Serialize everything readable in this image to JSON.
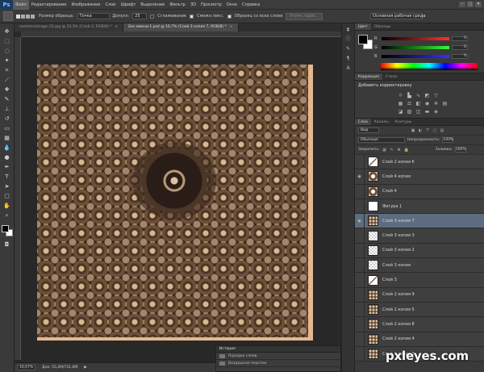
{
  "app": {
    "logo": "Ps",
    "menu": [
      "Файл",
      "Редактирование",
      "Изображение",
      "Слои",
      "Шрифт",
      "Выделение",
      "Фильтр",
      "3D",
      "Просмотр",
      "Окно",
      "Справка"
    ],
    "window_buttons": [
      "–",
      "□",
      "✕"
    ]
  },
  "options": {
    "sample_size_label": "Размер образца:",
    "sample_size_value": "Точка",
    "tolerance_label": "Допуск:",
    "tolerance_value": "25",
    "antialias_label": "Сглаживание",
    "contiguous_label": "Смежн.пикс.",
    "all_layers_label": "Образец со всех слоев",
    "refine_button": "Уточн. край...",
    "workspace": "Основная рабочая среда"
  },
  "tabs": [
    {
      "label": "seamlessimage (3).jpg @ 33,3% (Слой 2, RGB/8) *",
      "active": false
    },
    {
      "label": "Без имени-1.psd @ 16,7% (Слой 3 копия 7, RGB/8) *",
      "active": true
    }
  ],
  "status": {
    "zoom": "16,67%",
    "doc": "Док: 55,2M/731,6M"
  },
  "history": {
    "title": "История",
    "items": [
      "Порядок слоев",
      "Воздушная перспек"
    ]
  },
  "color_panel": {
    "tabs": [
      "Цвет",
      "Образцы"
    ],
    "channels": [
      {
        "letter": "R",
        "value": "0",
        "color": "#ff3030"
      },
      {
        "letter": "G",
        "value": "0",
        "color": "#30ff30"
      },
      {
        "letter": "B",
        "value": "0",
        "color": "#3030ff"
      }
    ]
  },
  "adjustments": {
    "tabs": [
      "Коррекция",
      "Стили"
    ],
    "title": "Добавить корректировку"
  },
  "layers": {
    "tabs": [
      "Слои",
      "Каналы",
      "Контуры"
    ],
    "filter_kind": "Вид",
    "blend_mode": "Обычные",
    "opacity_label": "Непрозрачность:",
    "opacity_value": "100%",
    "lock_label": "Закрепить:",
    "fill_label": "Заливка:",
    "fill_value": "100%",
    "items": [
      {
        "name": "Слой 2 копия 6",
        "visible": false,
        "thumb": "thumb-diag",
        "selected": false
      },
      {
        "name": "Слой 4 копия",
        "visible": true,
        "thumb": "thumb-burst",
        "selected": false
      },
      {
        "name": "Слой 4",
        "visible": false,
        "thumb": "thumb-burst",
        "selected": false
      },
      {
        "name": "Фигура 1",
        "visible": false,
        "thumb": "thumb-shape",
        "selected": false
      },
      {
        "name": "Слой 3 копия 7",
        "visible": true,
        "thumb": "thumb-pattern",
        "selected": true
      },
      {
        "name": "Слой 3 копия 3",
        "visible": false,
        "thumb": "thumb-check",
        "selected": false
      },
      {
        "name": "Слой 3 копия 2",
        "visible": false,
        "thumb": "thumb-check",
        "selected": false
      },
      {
        "name": "Слой 3 копия",
        "visible": false,
        "thumb": "thumb-check",
        "selected": false
      },
      {
        "name": "Слой 3",
        "visible": false,
        "thumb": "thumb-diag",
        "selected": false
      },
      {
        "name": "Слой 2 копия 9",
        "visible": false,
        "thumb": "thumb-pattern",
        "selected": false
      },
      {
        "name": "Слой 2 копия 5",
        "visible": false,
        "thumb": "thumb-pattern",
        "selected": false
      },
      {
        "name": "Слой 2 копия 8",
        "visible": false,
        "thumb": "thumb-pattern",
        "selected": false
      },
      {
        "name": "Слой 2 копия 4",
        "visible": false,
        "thumb": "thumb-pattern",
        "selected": false
      },
      {
        "name": "Слой 2 копия 3",
        "visible": false,
        "thumb": "thumb-pattern",
        "selected": false
      }
    ]
  },
  "watermark": {
    "text": "pxleyes",
    "suffix": ".com"
  }
}
